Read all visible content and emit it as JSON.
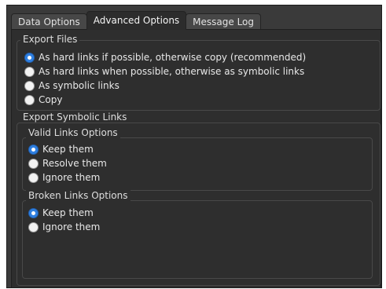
{
  "tabs": [
    {
      "label": "Data Options",
      "active": false
    },
    {
      "label": "Advanced Options",
      "active": true
    },
    {
      "label": "Message Log",
      "active": false
    }
  ],
  "export_files": {
    "title": "Export Files",
    "options": [
      {
        "label": "As hard links if possible, otherwise copy (recommended)",
        "selected": true
      },
      {
        "label": "As hard links when possible, otherwise as symbolic links",
        "selected": false
      },
      {
        "label": "As symbolic links",
        "selected": false
      },
      {
        "label": "Copy",
        "selected": false
      }
    ]
  },
  "export_symbolic_links": {
    "title": "Export Symbolic Links",
    "valid_links": {
      "title": "Valid Links Options",
      "options": [
        {
          "label": "Keep them",
          "selected": true
        },
        {
          "label": "Resolve them",
          "selected": false
        },
        {
          "label": "Ignore them",
          "selected": false
        }
      ]
    },
    "broken_links": {
      "title": "Broken Links Options",
      "options": [
        {
          "label": "Keep them",
          "selected": true
        },
        {
          "label": "Ignore them",
          "selected": false
        }
      ]
    }
  },
  "colors": {
    "window_bg": "#3a3a3a",
    "panel_bg": "#2e2e2e",
    "radio_selected": "#2f7fe0",
    "radio_unselected": "#f2f2f2",
    "text": "#e8e8e8"
  }
}
